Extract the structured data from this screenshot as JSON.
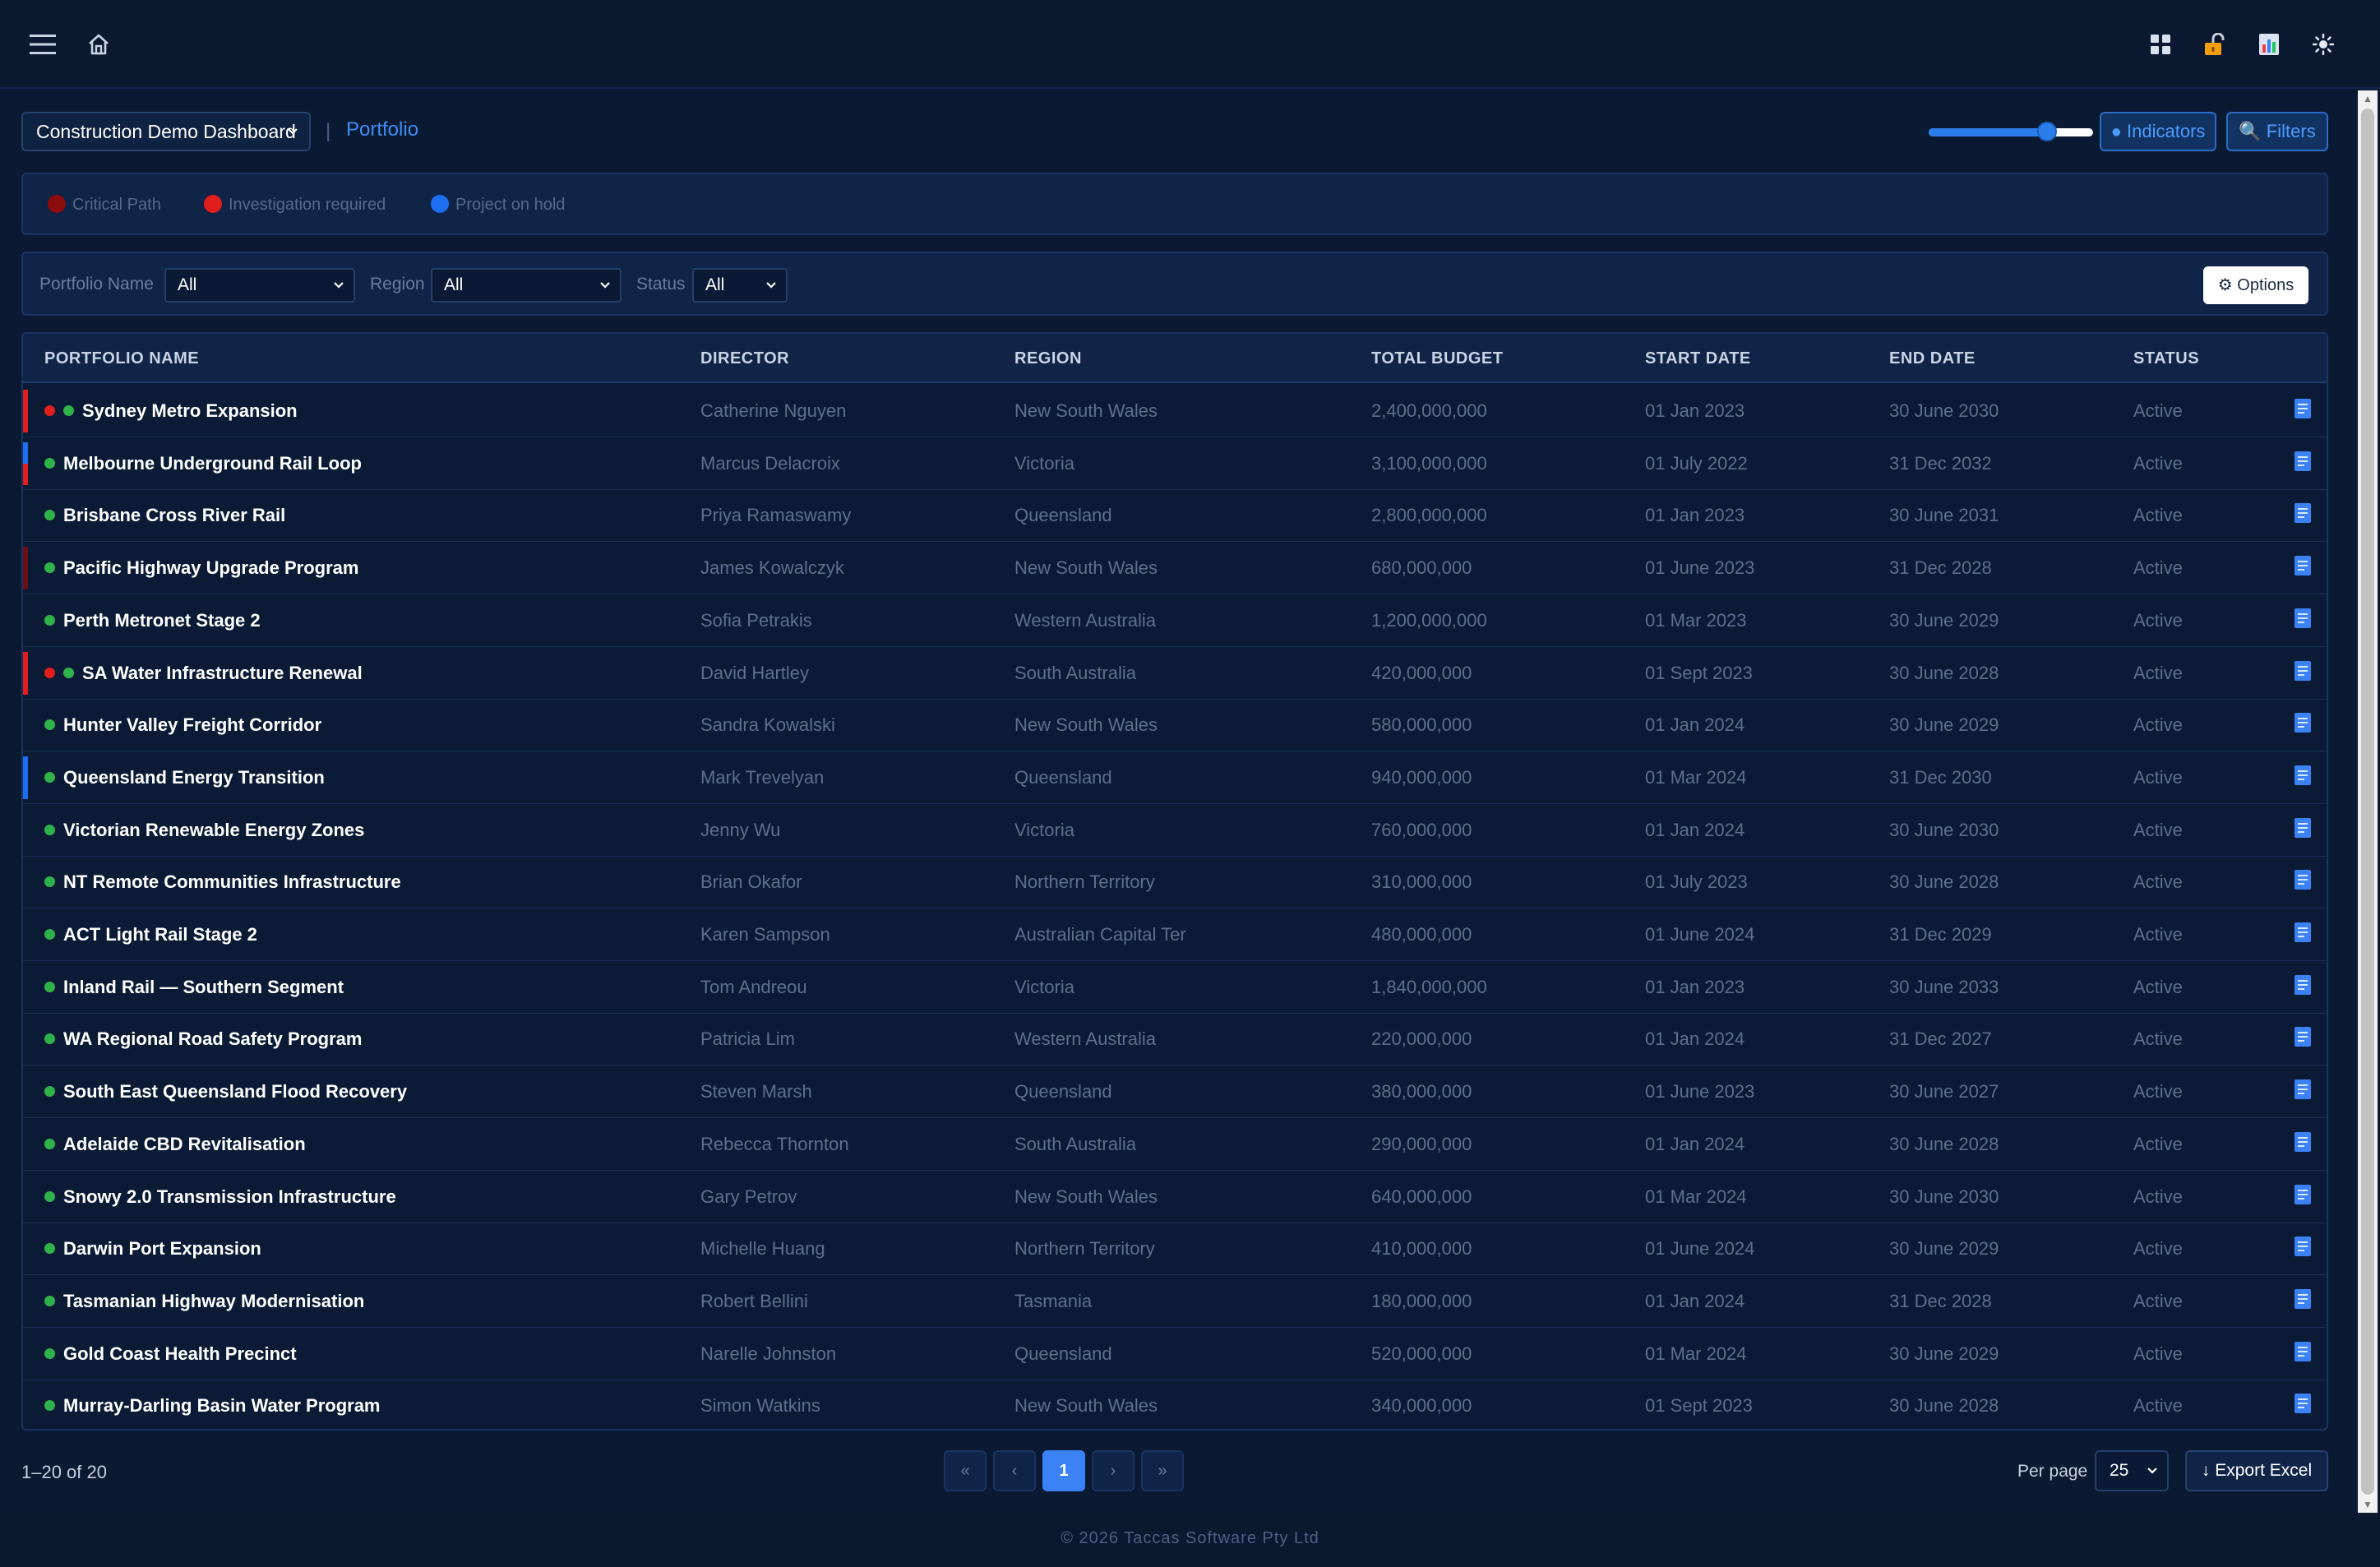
{
  "topbar": {
    "menu_icon": "menu-icon",
    "home_icon": "home-icon",
    "right_icons": [
      "grid-icon",
      "unlock-icon",
      "report-icon",
      "sun-icon"
    ]
  },
  "header": {
    "dashboard_select": "Construction Demo Dashboard",
    "separator": "|",
    "breadcrumb": "Portfolio",
    "zoom_slider_value": 0.72,
    "indicators_label": "● Indicators",
    "filters_label": "🔍 Filters"
  },
  "legend": [
    {
      "label": "Critical Path",
      "color": "#8b0d0d"
    },
    {
      "label": "Investigation required",
      "color": "#e11d1d"
    },
    {
      "label": "Project on hold",
      "color": "#1d6ff2"
    }
  ],
  "filters": {
    "portfolio_name_label": "Portfolio Name",
    "portfolio_name_value": "All",
    "region_label": "Region",
    "region_value": "All",
    "status_label": "Status",
    "status_value": "All",
    "options_label": "⚙ Options"
  },
  "table": {
    "columns": [
      "PORTFOLIO NAME",
      "DIRECTOR",
      "REGION",
      "TOTAL BUDGET",
      "START DATE",
      "END DATE",
      "STATUS"
    ],
    "rows": [
      {
        "name": "Sydney Metro Expansion",
        "director": "Catherine Nguyen",
        "region": "New South Wales",
        "budget": "2,400,000,000",
        "start": "01 Jan 2023",
        "end": "30 June 2030",
        "status": "Active",
        "bar": "#e11d1d",
        "red_dot": true
      },
      {
        "name": "Melbourne Underground Rail Loop",
        "director": "Marcus Delacroix",
        "region": "Victoria",
        "budget": "3,100,000,000",
        "start": "01 July 2022",
        "end": "31 Dec 2032",
        "status": "Active",
        "bar": "split",
        "red_dot": false
      },
      {
        "name": "Brisbane Cross River Rail",
        "director": "Priya Ramaswamy",
        "region": "Queensland",
        "budget": "2,800,000,000",
        "start": "01 Jan 2023",
        "end": "30 June 2031",
        "status": "Active",
        "bar": "",
        "red_dot": false
      },
      {
        "name": "Pacific Highway Upgrade Program",
        "director": "James Kowalczyk",
        "region": "New South Wales",
        "budget": "680,000,000",
        "start": "01 June 2023",
        "end": "31 Dec 2028",
        "status": "Active",
        "bar": "#6b0f14",
        "red_dot": false
      },
      {
        "name": "Perth Metronet Stage 2",
        "director": "Sofia Petrakis",
        "region": "Western Australia",
        "budget": "1,200,000,000",
        "start": "01 Mar 2023",
        "end": "30 June 2029",
        "status": "Active",
        "bar": "",
        "red_dot": false
      },
      {
        "name": "SA Water Infrastructure Renewal",
        "director": "David Hartley",
        "region": "South Australia",
        "budget": "420,000,000",
        "start": "01 Sept 2023",
        "end": "30 June 2028",
        "status": "Active",
        "bar": "#e11d1d",
        "red_dot": true
      },
      {
        "name": "Hunter Valley Freight Corridor",
        "director": "Sandra Kowalski",
        "region": "New South Wales",
        "budget": "580,000,000",
        "start": "01 Jan 2024",
        "end": "30 June 2029",
        "status": "Active",
        "bar": "",
        "red_dot": false
      },
      {
        "name": "Queensland Energy Transition",
        "director": "Mark Trevelyan",
        "region": "Queensland",
        "budget": "940,000,000",
        "start": "01 Mar 2024",
        "end": "31 Dec 2030",
        "status": "Active",
        "bar": "#1d6ff2",
        "red_dot": false
      },
      {
        "name": "Victorian Renewable Energy Zones",
        "director": "Jenny Wu",
        "region": "Victoria",
        "budget": "760,000,000",
        "start": "01 Jan 2024",
        "end": "30 June 2030",
        "status": "Active",
        "bar": "",
        "red_dot": false
      },
      {
        "name": "NT Remote Communities Infrastructure",
        "director": "Brian Okafor",
        "region": "Northern Territory",
        "budget": "310,000,000",
        "start": "01 July 2023",
        "end": "30 June 2028",
        "status": "Active",
        "bar": "",
        "red_dot": false
      },
      {
        "name": "ACT Light Rail Stage 2",
        "director": "Karen Sampson",
        "region": "Australian Capital Ter",
        "budget": "480,000,000",
        "start": "01 June 2024",
        "end": "31 Dec 2029",
        "status": "Active",
        "bar": "",
        "red_dot": false
      },
      {
        "name": "Inland Rail — Southern Segment",
        "director": "Tom Andreou",
        "region": "Victoria",
        "budget": "1,840,000,000",
        "start": "01 Jan 2023",
        "end": "30 June 2033",
        "status": "Active",
        "bar": "",
        "red_dot": false
      },
      {
        "name": "WA Regional Road Safety Program",
        "director": "Patricia Lim",
        "region": "Western Australia",
        "budget": "220,000,000",
        "start": "01 Jan 2024",
        "end": "31 Dec 2027",
        "status": "Active",
        "bar": "",
        "red_dot": false
      },
      {
        "name": "South East Queensland Flood Recovery",
        "director": "Steven Marsh",
        "region": "Queensland",
        "budget": "380,000,000",
        "start": "01 June 2023",
        "end": "30 June 2027",
        "status": "Active",
        "bar": "",
        "red_dot": false
      },
      {
        "name": "Adelaide CBD Revitalisation",
        "director": "Rebecca Thornton",
        "region": "South Australia",
        "budget": "290,000,000",
        "start": "01 Jan 2024",
        "end": "30 June 2028",
        "status": "Active",
        "bar": "",
        "red_dot": false
      },
      {
        "name": "Snowy 2.0 Transmission Infrastructure",
        "director": "Gary Petrov",
        "region": "New South Wales",
        "budget": "640,000,000",
        "start": "01 Mar 2024",
        "end": "30 June 2030",
        "status": "Active",
        "bar": "",
        "red_dot": false
      },
      {
        "name": "Darwin Port Expansion",
        "director": "Michelle Huang",
        "region": "Northern Territory",
        "budget": "410,000,000",
        "start": "01 June 2024",
        "end": "30 June 2029",
        "status": "Active",
        "bar": "",
        "red_dot": false
      },
      {
        "name": "Tasmanian Highway Modernisation",
        "director": "Robert Bellini",
        "region": "Tasmania",
        "budget": "180,000,000",
        "start": "01 Jan 2024",
        "end": "31 Dec 2028",
        "status": "Active",
        "bar": "",
        "red_dot": false
      },
      {
        "name": "Gold Coast Health Precinct",
        "director": "Narelle Johnston",
        "region": "Queensland",
        "budget": "520,000,000",
        "start": "01 Mar 2024",
        "end": "30 June 2029",
        "status": "Active",
        "bar": "",
        "red_dot": false
      },
      {
        "name": "Murray-Darling Basin Water Program",
        "director": "Simon Watkins",
        "region": "New South Wales",
        "budget": "340,000,000",
        "start": "01 Sept 2023",
        "end": "30 June 2028",
        "status": "Active",
        "bar": "",
        "red_dot": false
      }
    ]
  },
  "pagination": {
    "info": "1–20 of 20",
    "first": "«",
    "prev": "‹",
    "current": "1",
    "next": "›",
    "last": "»",
    "per_page_label": "Per page",
    "per_page_value": "25",
    "export_label": "↓ Export Excel"
  },
  "footer": {
    "text": "© 2026 Taccas Software Pty Ltd"
  },
  "colors": {
    "accent": "#3b82f6",
    "link": "#3d8df5",
    "status_green": "#2fb24c",
    "critical_red": "#e11d1d",
    "on_hold_blue": "#1d6ff2"
  }
}
